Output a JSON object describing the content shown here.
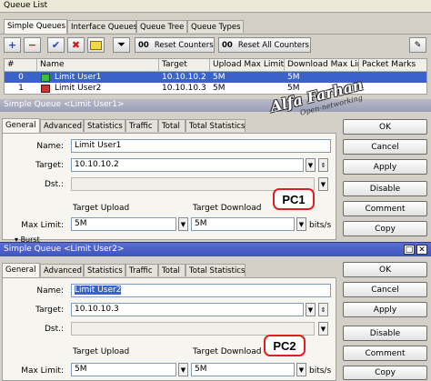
{
  "queue_list": {
    "title": "Queue List",
    "tabs": [
      "Simple Queues",
      "Interface Queues",
      "Queue Tree",
      "Queue Types"
    ],
    "toolbar": {
      "reset_counters": "Reset Counters",
      "reset_all_counters": "Reset All Counters",
      "oo_glyph": "00"
    },
    "columns": [
      "#",
      "Name",
      "Target",
      "Upload Max Limit",
      "Download Max Limit",
      "Packet Marks"
    ],
    "rows": [
      {
        "num": "0",
        "name": "Limit User1",
        "target": "10.10.10.2",
        "upload": "5M",
        "download": "5M"
      },
      {
        "num": "1",
        "name": "Limit User2",
        "target": "10.10.10.3",
        "upload": "5M",
        "download": "5M"
      }
    ]
  },
  "watermark": {
    "name": "Alfa Farhan",
    "tagline": "Open-networking"
  },
  "dialog1": {
    "title": "Simple Queue <Limit User1>",
    "tabs": [
      "General",
      "Advanced",
      "Statistics",
      "Traffic",
      "Total",
      "Total Statistics"
    ],
    "name_label": "Name:",
    "name_value": "Limit User1",
    "target_label": "Target:",
    "target_value": "10.10.10.2",
    "dst_label": "Dst.:",
    "target_upload_label": "Target Upload",
    "target_download_label": "Target Download",
    "max_limit_label": "Max Limit:",
    "upload_value": "5M",
    "download_value": "5M",
    "unit": "bits/s",
    "burst_label": "Burst",
    "badge": "PC1",
    "buttons": [
      "OK",
      "Cancel",
      "Apply",
      "Disable",
      "Comment",
      "Copy"
    ]
  },
  "dialog2": {
    "title": "Simple Queue <Limit User2>",
    "tabs": [
      "General",
      "Advanced",
      "Statistics",
      "Traffic",
      "Total",
      "Total Statistics"
    ],
    "name_label": "Name:",
    "name_value": "Limit User2",
    "target_label": "Target:",
    "target_value": "10.10.10.3",
    "dst_label": "Dst.:",
    "target_upload_label": "Target Upload",
    "target_download_label": "Target Download",
    "max_limit_label": "Max Limit:",
    "upload_value": "5M",
    "download_value": "5M",
    "unit": "bits/s",
    "badge": "PC2",
    "buttons": [
      "OK",
      "Cancel",
      "Apply",
      "Disable",
      "Comment",
      "Copy"
    ]
  },
  "colors": {
    "active_title": "#3f53c0",
    "selected_row": "#3b62c8",
    "badge_border": "#e02020"
  }
}
